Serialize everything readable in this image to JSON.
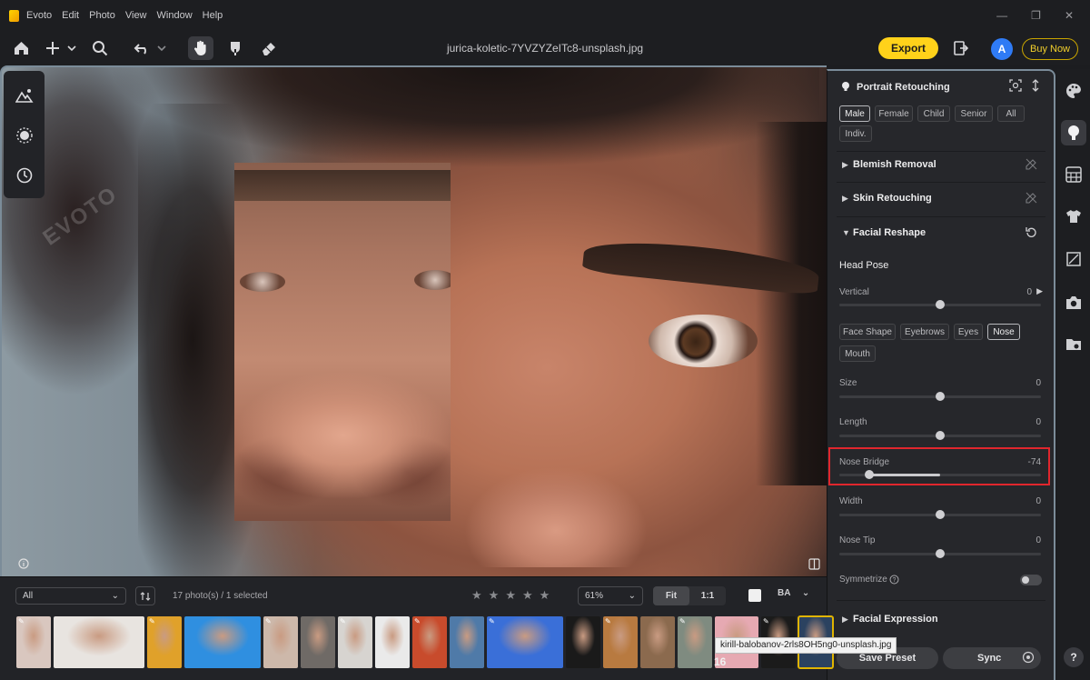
{
  "app": {
    "name": "Evoto",
    "menu": [
      "Edit",
      "Photo",
      "View",
      "Window",
      "Help"
    ],
    "brand_color": "#ffd21a",
    "window_controls": [
      "minimize-icon",
      "restore-icon",
      "close-icon"
    ]
  },
  "toolbar": {
    "icons": [
      "home-icon",
      "add-icon",
      "search-icon",
      "undo-icon",
      "hand-icon",
      "brush-icon",
      "eraser-icon"
    ],
    "file_name": "jurica-koletic-7YVZYZeITc8-unsplash.jpg",
    "export_label": "Export",
    "avatar_letter": "A",
    "buy_now_label": "Buy Now"
  },
  "canvas": {
    "watermark": "EVOTO",
    "left_tools": [
      "adjust-mountain-icon",
      "mask-circle-icon",
      "history-icon"
    ]
  },
  "panel": {
    "title": "Portrait Retouching",
    "gender_chips": [
      {
        "label": "Male",
        "selected": true
      },
      {
        "label": "Female",
        "selected": false
      },
      {
        "label": "Child",
        "selected": false
      },
      {
        "label": "Senior",
        "selected": false
      },
      {
        "label": "All",
        "selected": false
      },
      {
        "label": "Indiv.",
        "selected": false
      }
    ],
    "sections": {
      "blemish": "Blemish Removal",
      "skin": "Skin Retouching",
      "facial_reshape": "Facial Reshape",
      "facial_expression": "Facial Expression"
    },
    "head_pose": {
      "title": "Head Pose",
      "vertical_label": "Vertical",
      "vertical_value": "0"
    },
    "feature_chips": [
      {
        "label": "Face Shape",
        "selected": false
      },
      {
        "label": "Eyebrows",
        "selected": false
      },
      {
        "label": "Eyes",
        "selected": false
      },
      {
        "label": "Nose",
        "selected": true
      },
      {
        "label": "Mouth",
        "selected": false
      }
    ],
    "sliders": [
      {
        "label": "Size",
        "value": "0",
        "level": 0
      },
      {
        "label": "Length",
        "value": "0",
        "level": 0
      },
      {
        "label": "Nose Bridge",
        "value": "-74",
        "level": -74
      },
      {
        "label": "Width",
        "value": "0",
        "level": 0
      },
      {
        "label": "Nose Tip",
        "value": "0",
        "level": 0
      }
    ],
    "symmetrize_label": "Symmetrize",
    "symmetrize_on": false,
    "save_preset_label": "Save Preset",
    "sync_label": "Sync",
    "highlight_color": "#e0262d"
  },
  "right_strip": {
    "icons": [
      "palette-icon",
      "portrait-icon",
      "grid-filter-icon",
      "shirt-icon",
      "crop-icon",
      "camera-icon",
      "folder-eye-icon"
    ],
    "help_label": "?"
  },
  "filmstrip": {
    "filter_value": "All",
    "count_text": "17 photo(s) / 1 selected",
    "stars": 5,
    "zoom_value": "61%",
    "fit_label": "Fit",
    "one_to_one_label": "1:1",
    "ba_label": "BA",
    "tooltip": "kirill-balobanov-2rls8OH5ng0-unsplash.jpg",
    "badge_count": "16",
    "thumb_colors": [
      "#d9c7bf",
      "#e8e4e0",
      "#e0a12a",
      "#2f8fe0",
      "#cdb8aa",
      "#6f6a66",
      "#d7d4d0",
      "#eaeaea",
      "#c84b2c",
      "#4f7aa8",
      "#3a6fd8",
      "#1a1a1a",
      "#b87a40",
      "#8b6a4e",
      "#7f8b80",
      "#e6a9b2",
      "#1b1b1b",
      "#2b4260"
    ]
  }
}
